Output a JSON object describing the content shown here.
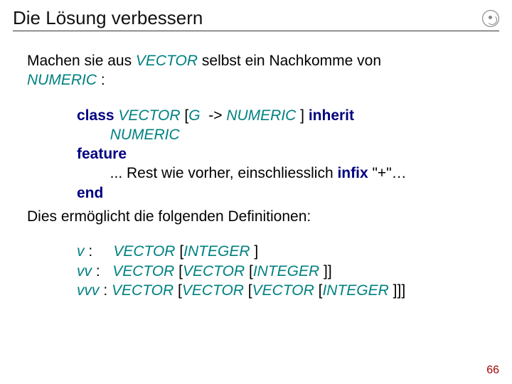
{
  "title": "Die Lösung verbessern",
  "intro_before": "Machen sie aus ",
  "intro_cl1": "VECTOR",
  "intro_mid": " selbst ein Nachkomme von ",
  "intro_cl2": "NUMERIC",
  "intro_after": " :",
  "kw_class": "class",
  "cl_vector": "VECTOR",
  "g_open": " [",
  "g_g": "G ",
  "g_arrow": " -> ",
  "cl_numeric": "NUMERIC ",
  "g_close": "] ",
  "kw_inherit": "inherit",
  "indent_numeric": "        ",
  "kw_feature": "feature",
  "rest_indent": "        ... ",
  "rest_text": "Rest wie vorher, einschliesslich ",
  "kw_infix": "infix",
  "rest_quote": " \"+\"…",
  "kw_end": "end",
  "para2": "Dies ermöglicht die folgenden Definitionen:",
  "v_var": "v",
  "v_colon": " :     ",
  "v_type": "VECTOR ",
  "v_open": "[",
  "v_int": "INTEGER ",
  "v_close": "]",
  "vv_var": "vv",
  "vv_colon": " :   ",
  "vvv_var": "vvv",
  "vvv_colon": " : ",
  "page": "66"
}
